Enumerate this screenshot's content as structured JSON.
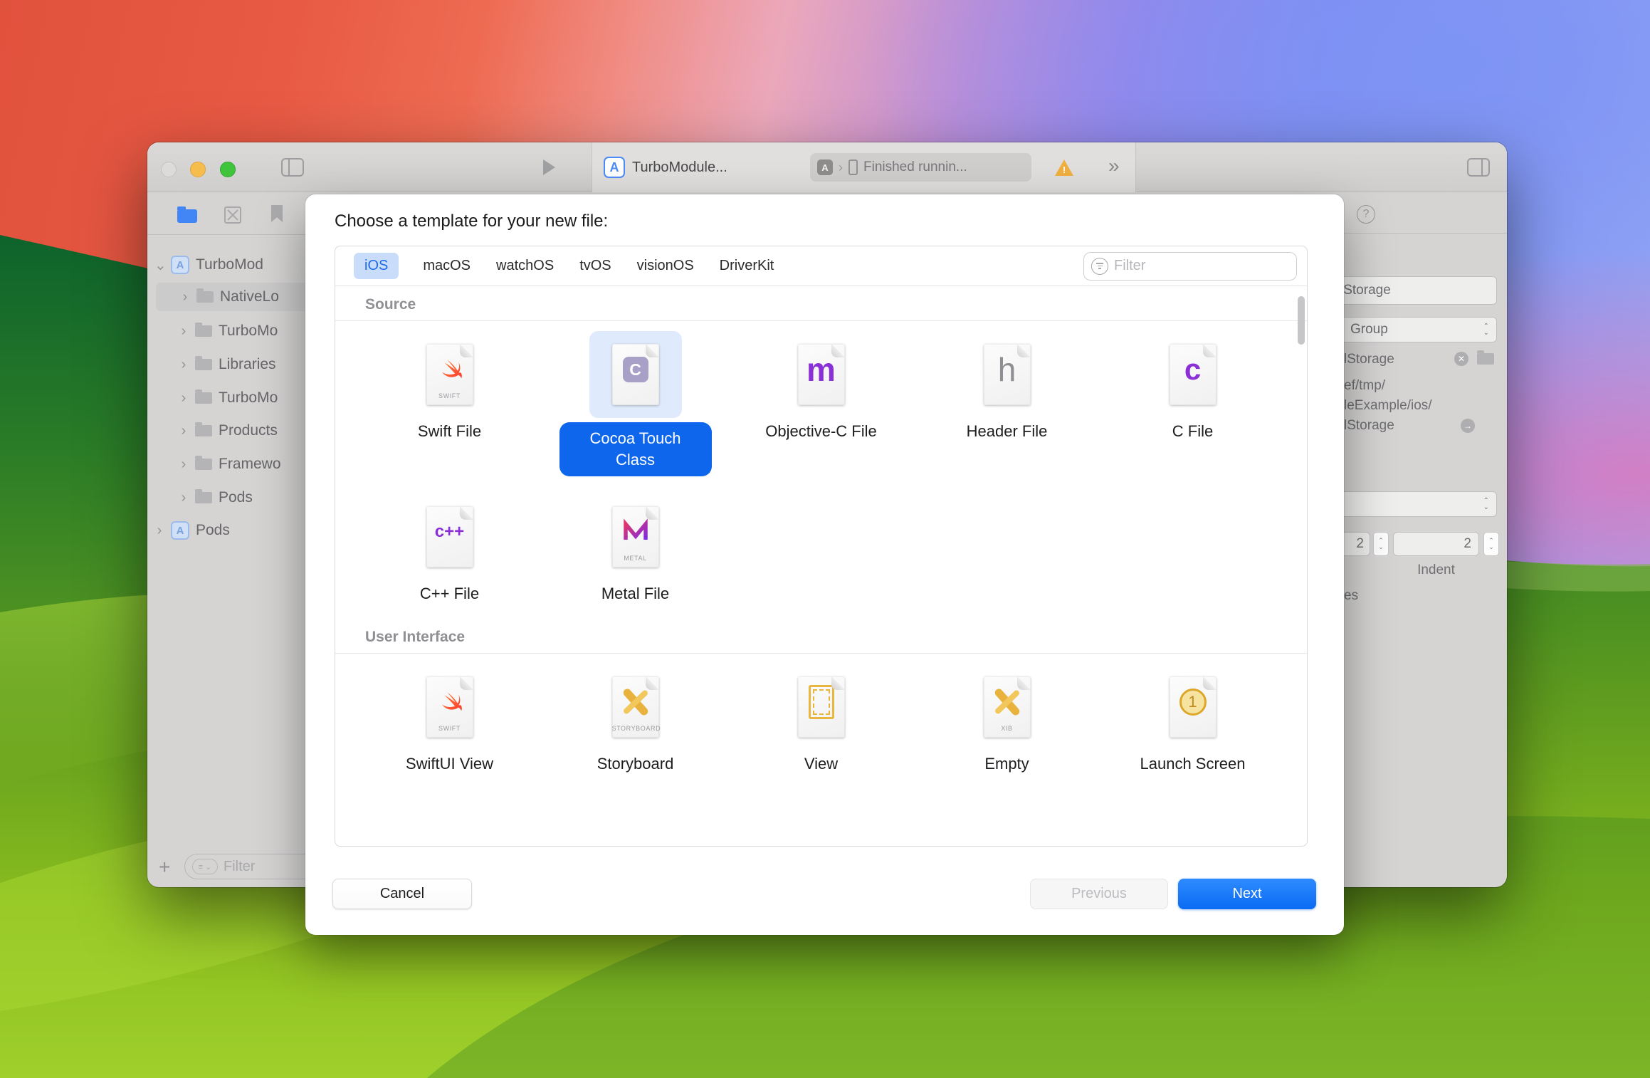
{
  "window": {
    "title_tab": "TurboModule...",
    "status_text": "Finished runnin...",
    "project_icon_glyph": "A",
    "sidebar": {
      "tree": [
        {
          "label": "TurboMod"
        },
        {
          "label": "NativeLo"
        },
        {
          "label": "TurboMo"
        },
        {
          "label": "Libraries"
        },
        {
          "label": "TurboMo"
        },
        {
          "label": "Products"
        },
        {
          "label": "Framewo"
        },
        {
          "label": "Pods"
        },
        {
          "label": "Pods"
        }
      ],
      "filter_placeholder": "Filter"
    },
    "inspector": {
      "name_field_value": "lStorage",
      "type_dropdown_value": "Group",
      "location_file": "lStorage",
      "path_lines": [
        "ef/tmp/",
        "leExample/ios/",
        "lStorage"
      ],
      "indent_left_value": "2",
      "indent_value": "2",
      "indent_label": "Indent",
      "bottom_text": "es"
    }
  },
  "dialog": {
    "title": "Choose a template for your new file:",
    "tabs": [
      "iOS",
      "macOS",
      "watchOS",
      "tvOS",
      "visionOS",
      "DriverKit"
    ],
    "active_tab": "iOS",
    "filter_placeholder": "Filter",
    "sections": [
      {
        "title": "Source",
        "items": [
          {
            "label": "Swift File",
            "badge": "SWIFT"
          },
          {
            "label": "Cocoa Touch Class",
            "glyph": "C",
            "selected": true
          },
          {
            "label": "Objective-C File",
            "glyph": "m"
          },
          {
            "label": "Header File",
            "glyph": "h"
          },
          {
            "label": "C File",
            "glyph": "c"
          },
          {
            "label": "C++ File",
            "glyph": "c++"
          },
          {
            "label": "Metal File",
            "badge": "METAL"
          }
        ]
      },
      {
        "title": "User Interface",
        "items": [
          {
            "label": "SwiftUI View",
            "badge": "SWIFT"
          },
          {
            "label": "Storyboard",
            "badge": "STORYBOARD"
          },
          {
            "label": "View"
          },
          {
            "label": "Empty",
            "badge": "XIB"
          },
          {
            "label": "Launch Screen",
            "glyph": "1"
          }
        ]
      }
    ],
    "buttons": {
      "cancel": "Cancel",
      "previous": "Previous",
      "next": "Next"
    },
    "colors": {
      "accent": "#0d66eb",
      "selection_bg": "#dfeafc",
      "tab_pill_bg": "#c9ddfb",
      "tab_pill_text": "#1a6ce5",
      "warning": "#f0b040"
    }
  }
}
